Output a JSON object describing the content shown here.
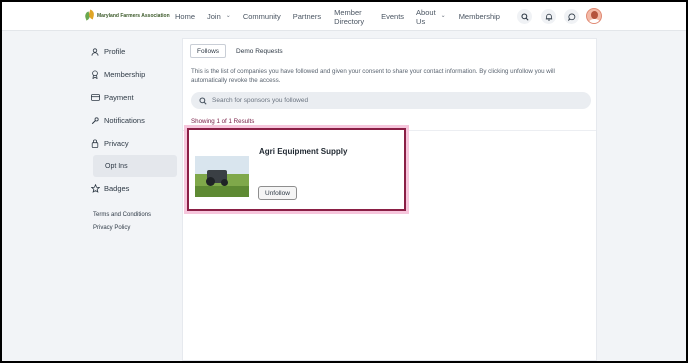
{
  "brand": {
    "name": "Maryland Farmers Association"
  },
  "nav": {
    "items": [
      {
        "label": "Home",
        "caret": false
      },
      {
        "label": "Join",
        "caret": true
      },
      {
        "label": "Community",
        "caret": false
      },
      {
        "label": "Partners",
        "caret": false
      },
      {
        "label": "Member\nDirectory",
        "caret": false
      },
      {
        "label": "Events",
        "caret": false
      },
      {
        "label": "About\nUs",
        "caret": true
      },
      {
        "label": "Membership",
        "caret": false
      }
    ],
    "icons": [
      "search-icon",
      "bell-icon",
      "chat-icon"
    ]
  },
  "sidebar": {
    "items": [
      {
        "label": "Profile",
        "icon": "user-icon"
      },
      {
        "label": "Membership",
        "icon": "badge-icon"
      },
      {
        "label": "Payment",
        "icon": "credit-card-icon"
      },
      {
        "label": "Notifications",
        "icon": "wrench-icon"
      },
      {
        "label": "Privacy",
        "icon": "lock-icon"
      },
      {
        "label": "Opt Ins",
        "icon": ""
      },
      {
        "label": "Badges",
        "icon": "star-icon"
      }
    ],
    "links": [
      "Terms and Conditions",
      "Privacy Policy"
    ]
  },
  "main": {
    "tabs": [
      {
        "label": "Follows",
        "active": true
      },
      {
        "label": "Demo Requests",
        "active": false
      }
    ],
    "description": "This is the list of companies you have followed and given your consent to share your contact information. By clicking unfollow you will automatically revoke the access.",
    "search_placeholder": "Search for sponsors you followed",
    "results_text": "Showing 1 of 1 Results",
    "cards": [
      {
        "title": "Agri Equipment Supply",
        "button": "Unfollow",
        "image": "tractor-in-field"
      }
    ]
  },
  "colors": {
    "accent": "#8a1f45",
    "highlight": "#f6c6dc"
  }
}
